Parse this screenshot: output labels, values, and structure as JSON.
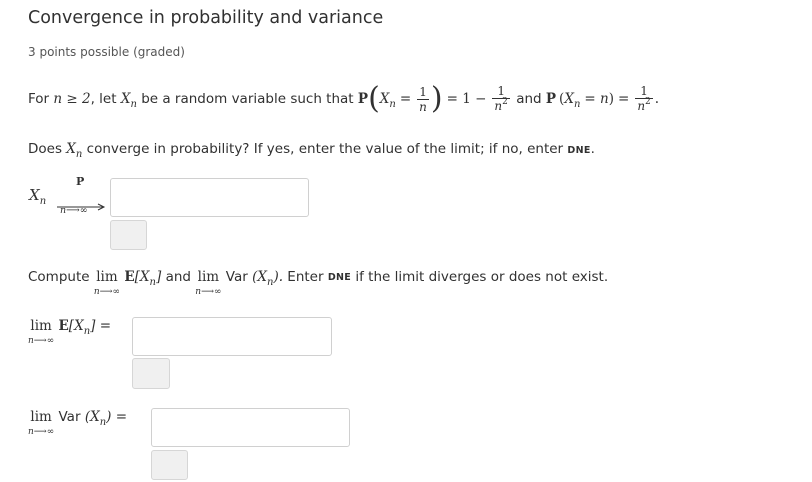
{
  "problem": {
    "title": "Convergence in probability and variance",
    "points": "3 points possible (graded)"
  },
  "statement": {
    "for": "For",
    "n_cond": "n ≥ 2",
    "let": ", let",
    "xn_x": "X",
    "xn_n": "n",
    "be_rv": "be a random variable such that",
    "P": "P",
    "eq_lhs_x": "X",
    "eq_lhs_n": "n",
    "equals": "=",
    "frac1_num": "1",
    "frac1_den": "n",
    "one_minus": "= 1 −",
    "frac2_num": "1",
    "frac2_den": "n",
    "sq": "2",
    "and": "and",
    "P2": "P",
    "x2": "X",
    "x2n": "n",
    "eq_n": "= n",
    "eq2": "=",
    "frac3_num": "1",
    "frac3_den": "n",
    "sq2": "2",
    "dot": "."
  },
  "question1": {
    "text": "Does",
    "xn": "X",
    "xn_sub": "n",
    "rest": "converge in probability? If yes, enter the value of the limit; if no, enter",
    "dne": "DNE",
    "end": ".",
    "label_x": "X",
    "label_n": "n",
    "arrow_top": "P",
    "arrow_bottom": "n⟶∞"
  },
  "question2": {
    "compute": "Compute",
    "lim1": "lim",
    "lim1_sub": "n⟶∞",
    "E": "E",
    "Xn1": "[X",
    "Xn1_sub": "n",
    "Xn1_end": "]",
    "and": "and",
    "lim2": "lim",
    "lim2_sub": "n⟶∞",
    "var": "Var",
    "var_arg": "(X",
    "var_sub": "n",
    "var_end": ").",
    "enter": "Enter",
    "dne": "DNE",
    "rest": "if the limit diverges or does not exist."
  },
  "answer_e": {
    "lim": "lim",
    "lim_sub": "n⟶∞",
    "E": "E",
    "arg": "[X",
    "arg_sub": "n",
    "arg_end": "] ="
  },
  "answer_var": {
    "lim": "lim",
    "lim_sub": "n⟶∞",
    "var": "Var",
    "arg": "(X",
    "arg_sub": "n",
    "arg_end": ") ="
  },
  "inputs": {
    "xn_value": "",
    "e_value": "",
    "var_value": ""
  }
}
